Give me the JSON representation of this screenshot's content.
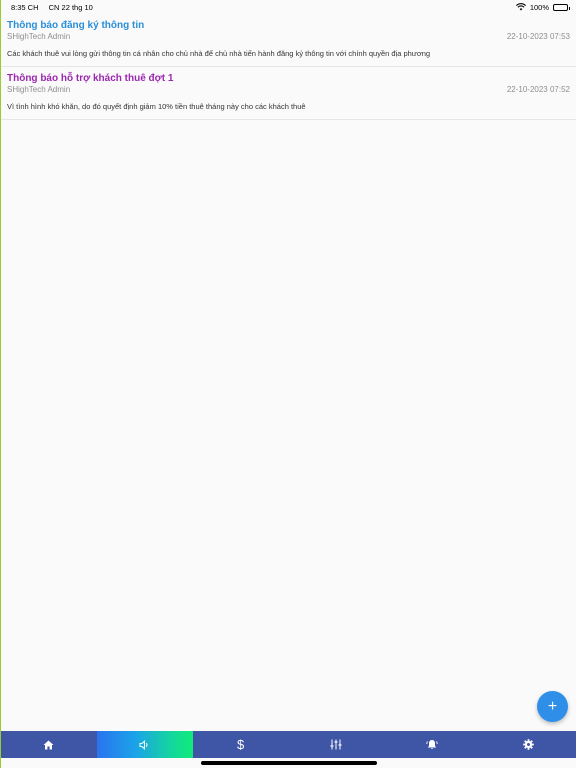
{
  "status_bar": {
    "time": "8:35 CH",
    "date": "CN 22 thg 10",
    "battery": "100%",
    "icons": [
      "wifi-icon",
      "battery-icon"
    ]
  },
  "notices": [
    {
      "title": "Thông báo đăng ký thông tin",
      "title_color": "#2a8ed8",
      "author": "SHighTech Admin",
      "date": "22-10-2023 07:53",
      "body": "Các khách thuê vui lòng gửi thông tin cá nhân cho chủ nhà để chủ nhà tiến hành đăng ký thông tin với chính quyền địa phương"
    },
    {
      "title": "Thông báo hỗ trợ khách thuê đợt 1",
      "title_color": "#9c27b0",
      "author": "SHighTech Admin",
      "date": "22-10-2023 07:52",
      "body": "Vì tình hình khó khăn, do đó quyết định giảm 10% tiền thuê tháng này cho các khách thuê"
    }
  ],
  "fab": {
    "symbol": "+",
    "icon": "add-icon",
    "color": "#2f8fe8"
  },
  "tab_bar": {
    "color": "#3f55a5",
    "tabs": [
      {
        "name": "home",
        "icon": "home-icon",
        "symbol": "",
        "active": false
      },
      {
        "name": "announcements",
        "icon": "speaker-icon",
        "symbol": "",
        "active": true
      },
      {
        "name": "payments",
        "icon": "dollar-icon",
        "symbol": "$",
        "active": false
      },
      {
        "name": "settings-sliders",
        "icon": "sliders-icon",
        "symbol": "",
        "active": false
      },
      {
        "name": "alerts",
        "icon": "bell-icon",
        "symbol": "",
        "active": false
      },
      {
        "name": "settings",
        "icon": "gear-icon",
        "symbol": "",
        "active": false
      }
    ]
  }
}
